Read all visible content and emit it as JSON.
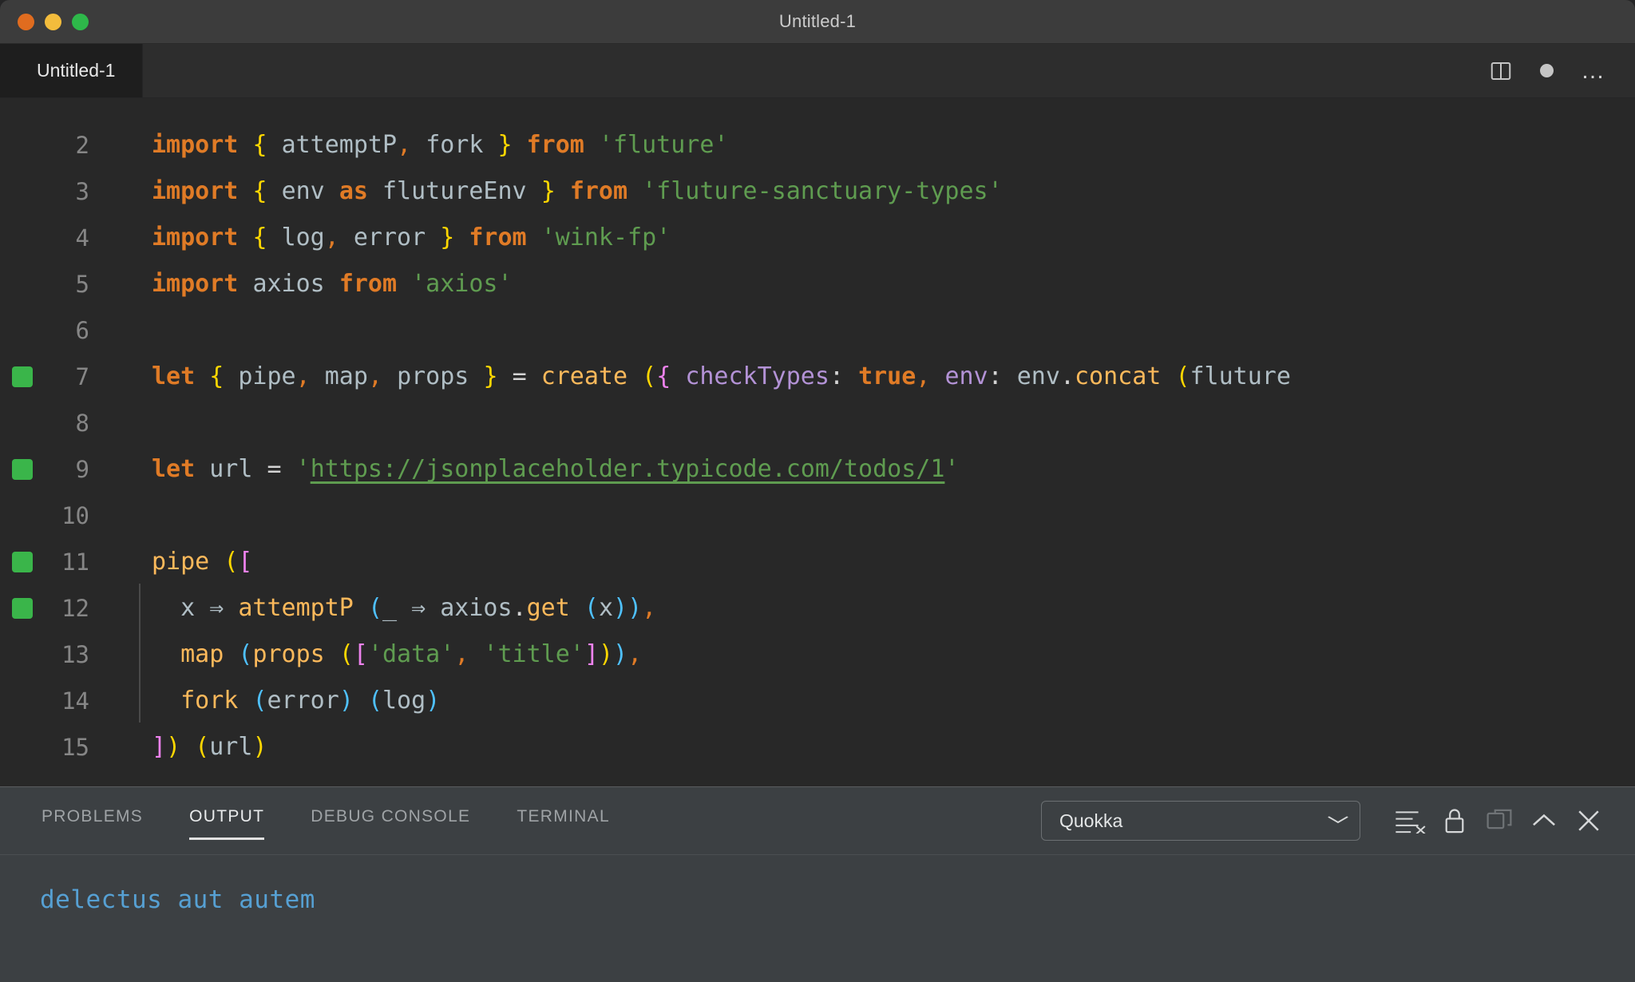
{
  "window": {
    "title": "Untitled-1",
    "traffic_lights": [
      {
        "name": "close",
        "color": "#e06c1f"
      },
      {
        "name": "minimize",
        "color": "#f3bc3c"
      },
      {
        "name": "maximize",
        "color": "#2eb84a"
      }
    ]
  },
  "editor_tab": {
    "label": "Untitled-1",
    "actions": [
      {
        "icon": "split-editor-icon"
      },
      {
        "icon": "unsaved-dot-icon"
      },
      {
        "icon": "more-actions-icon",
        "glyph": "…"
      }
    ]
  },
  "code": {
    "language": "javascript",
    "lines": [
      {
        "n": 2,
        "marker": false,
        "text": "import { attemptP, fork } from 'fluture'"
      },
      {
        "n": 3,
        "marker": false,
        "text": "import { env as flutureEnv } from 'fluture-sanctuary-types'"
      },
      {
        "n": 4,
        "marker": false,
        "text": "import { log, error } from 'wink-fp'"
      },
      {
        "n": 5,
        "marker": false,
        "text": "import axios from 'axios'"
      },
      {
        "n": 6,
        "marker": false,
        "text": ""
      },
      {
        "n": 7,
        "marker": true,
        "text": "let { pipe, map, props } = create ({ checkTypes: true, env: env.concat (fluture"
      },
      {
        "n": 8,
        "marker": false,
        "text": ""
      },
      {
        "n": 9,
        "marker": true,
        "text": "let url = 'https://jsonplaceholder.typicode.com/todos/1'"
      },
      {
        "n": 10,
        "marker": false,
        "text": ""
      },
      {
        "n": 11,
        "marker": true,
        "text": "pipe (["
      },
      {
        "n": 12,
        "marker": true,
        "text": "  x ⇒ attemptP (_ ⇒ axios.get (x)),"
      },
      {
        "n": 13,
        "marker": false,
        "text": "  map (props (['data', 'title'])),"
      },
      {
        "n": 14,
        "marker": false,
        "text": "  fork (error) (log)"
      },
      {
        "n": 15,
        "marker": false,
        "text": "]) (url)"
      }
    ],
    "url_value": "https://jsonplaceholder.typicode.com/todos/1",
    "colors": {
      "background": "#282828",
      "keyword": "#e07b26",
      "variable": "#b0bec5",
      "brace": "#ffd700",
      "string": "#5f9c50",
      "function": "#fcb95b",
      "property": "#b392d6",
      "bracket": "#ee82ee",
      "cyan_paren": "#4fc1ff",
      "line_number": "#868686",
      "gutter_marker": "#3ab54a"
    }
  },
  "panel": {
    "tabs": [
      {
        "label": "PROBLEMS",
        "active": false
      },
      {
        "label": "OUTPUT",
        "active": true
      },
      {
        "label": "DEBUG CONSOLE",
        "active": false
      },
      {
        "label": "TERMINAL",
        "active": false
      }
    ],
    "channel_select": {
      "value": "Quokka",
      "chevron": "⌄"
    },
    "actions": [
      {
        "icon": "clear-output-icon"
      },
      {
        "icon": "lock-scroll-icon"
      },
      {
        "icon": "open-new-window-icon"
      },
      {
        "icon": "chevron-up-icon",
        "glyph": "⌃"
      },
      {
        "icon": "close-panel-icon",
        "glyph": "✕"
      }
    ],
    "output_text": "delectus aut autem",
    "output_color": "#56a0d3"
  }
}
